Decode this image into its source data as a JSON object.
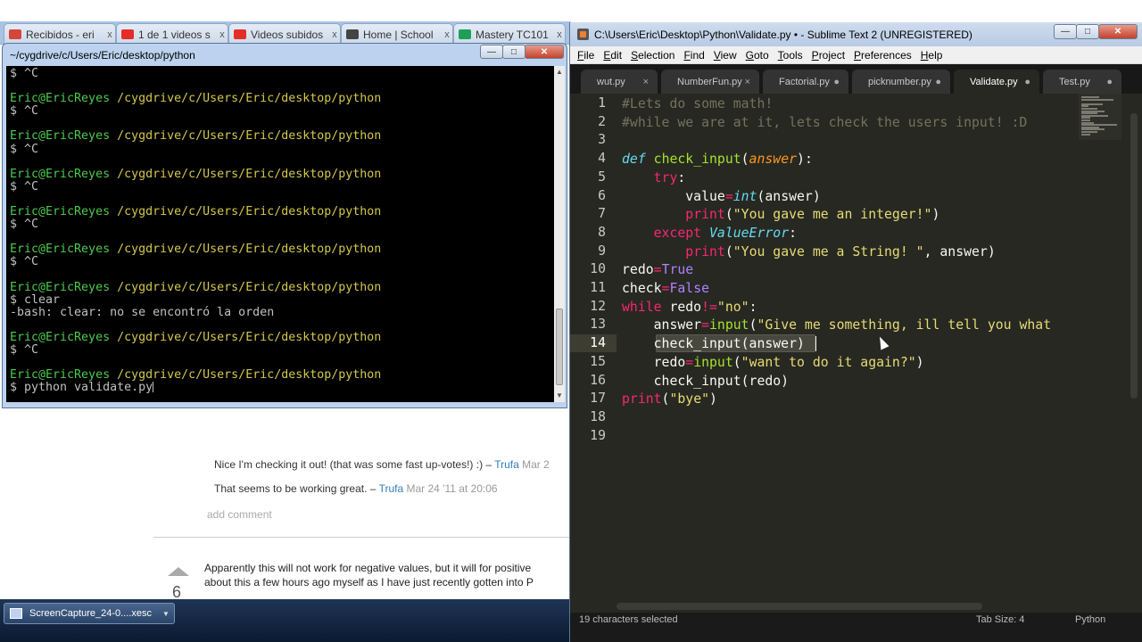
{
  "browser": {
    "tabs": [
      {
        "label": "Recibidos - eri",
        "icon": "gmail-icon",
        "color": "#d44638"
      },
      {
        "label": "1 de 1 videos s",
        "icon": "youtube-icon",
        "color": "#e52d27"
      },
      {
        "label": "Videos subidos",
        "icon": "youtube-icon",
        "color": "#e52d27"
      },
      {
        "label": "Home | School",
        "icon": "school-icon",
        "color": "#444444"
      },
      {
        "label": "Mastery TC101",
        "icon": "sheets-icon",
        "color": "#1e9e57"
      }
    ],
    "tab_close": "x",
    "comments": [
      {
        "text": "Nice I'm checking it out! (that was some fast up-votes!) :) –",
        "user": "Trufa",
        "date": "Mar 2"
      },
      {
        "text": "That seems to be working great. –",
        "user": "Trufa",
        "date": "Mar 24 '11 at 20:06"
      }
    ],
    "add_comment": "add comment",
    "vote_count": "6",
    "answer_lines": [
      "Apparently this will not work for negative values, but it will for positive",
      "about this a few hours ago myself as I have just recently gotten into P"
    ],
    "taskbar_item": "ScreenCapture_24-0....xesc"
  },
  "cygwin": {
    "title": "~/cygdrive/c/Users/Eric/desktop/python",
    "buttons": {
      "minimize": "—",
      "maximize": "□",
      "close": "✕"
    },
    "lines": [
      {
        "t": "$ ^C"
      },
      {
        "t": ""
      },
      {
        "user": "Eric@EricReyes",
        "path": "/cygdrive/c/Users/Eric/desktop/python"
      },
      {
        "t": "$ ^C"
      },
      {
        "t": ""
      },
      {
        "user": "Eric@EricReyes",
        "path": "/cygdrive/c/Users/Eric/desktop/python"
      },
      {
        "t": "$ ^C"
      },
      {
        "t": ""
      },
      {
        "user": "Eric@EricReyes",
        "path": "/cygdrive/c/Users/Eric/desktop/python"
      },
      {
        "t": "$ ^C"
      },
      {
        "t": ""
      },
      {
        "user": "Eric@EricReyes",
        "path": "/cygdrive/c/Users/Eric/desktop/python"
      },
      {
        "t": "$ ^C"
      },
      {
        "t": ""
      },
      {
        "user": "Eric@EricReyes",
        "path": "/cygdrive/c/Users/Eric/desktop/python"
      },
      {
        "t": "$ ^C"
      },
      {
        "t": ""
      },
      {
        "user": "Eric@EricReyes",
        "path": "/cygdrive/c/Users/Eric/desktop/python"
      },
      {
        "t": "$ clear"
      },
      {
        "t": "-bash: clear: no se encontró la orden"
      },
      {
        "t": ""
      },
      {
        "user": "Eric@EricReyes",
        "path": "/cygdrive/c/Users/Eric/desktop/python"
      },
      {
        "t": "$ ^C"
      },
      {
        "t": ""
      },
      {
        "user": "Eric@EricReyes",
        "path": "/cygdrive/c/Users/Eric/desktop/python"
      },
      {
        "t": "$ python validate.py",
        "cursor": true
      }
    ]
  },
  "sublime": {
    "title": "C:\\Users\\Eric\\Desktop\\Python\\Validate.py • - Sublime Text 2 (UNREGISTERED)",
    "buttons": {
      "minimize": "—",
      "maximize": "□",
      "close": "✕"
    },
    "menu": [
      {
        "u": "F",
        "rest": "ile"
      },
      {
        "u": "E",
        "rest": "dit"
      },
      {
        "u": "S",
        "rest": "election"
      },
      {
        "u": "F",
        "rest": "ind"
      },
      {
        "u": "V",
        "rest": "iew"
      },
      {
        "u": "G",
        "rest": "oto"
      },
      {
        "u": "T",
        "rest": "ools"
      },
      {
        "u": "P",
        "rest": "roject"
      },
      {
        "u": "P",
        "rest": "references"
      },
      {
        "u": "H",
        "rest": "elp"
      }
    ],
    "tabs": [
      {
        "label": "wut.py",
        "close": "×"
      },
      {
        "label": "NumberFun.py",
        "close": "×"
      },
      {
        "label": "Factorial.py",
        "close": "●"
      },
      {
        "label": "picknumber.py",
        "close": "●"
      },
      {
        "label": "Validate.py",
        "close": "●",
        "active": true
      },
      {
        "label": "Test.py",
        "close": "●"
      }
    ],
    "current_line": 14,
    "code": [
      [
        [
          "c",
          "#Lets do some math!"
        ]
      ],
      [
        [
          "c",
          "#while we are at it, lets check the users input! :D"
        ]
      ],
      [],
      [
        [
          "b",
          "def"
        ],
        [
          "",
          " "
        ],
        [
          "f",
          "check_input"
        ],
        [
          "",
          "("
        ],
        [
          "p",
          "answer"
        ],
        [
          "",
          "):"
        ]
      ],
      [
        [
          "",
          "    "
        ],
        [
          "k",
          "try"
        ],
        [
          "",
          ":"
        ]
      ],
      [
        [
          "",
          "        value"
        ],
        [
          "o",
          "="
        ],
        [
          "b",
          "int"
        ],
        [
          "",
          "(answer)"
        ]
      ],
      [
        [
          "",
          "        "
        ],
        [
          "k",
          "print"
        ],
        [
          "",
          "("
        ],
        [
          "s",
          "\"You gave me an integer!\""
        ],
        [
          "",
          ")"
        ]
      ],
      [
        [
          "",
          "    "
        ],
        [
          "k",
          "except"
        ],
        [
          "",
          " "
        ],
        [
          "b",
          "ValueError"
        ],
        [
          "",
          ":"
        ]
      ],
      [
        [
          "",
          "        "
        ],
        [
          "k",
          "print"
        ],
        [
          "",
          "("
        ],
        [
          "s",
          "\"You gave me a String! \""
        ],
        [
          "",
          ", answer)"
        ]
      ],
      [
        [
          "",
          "redo"
        ],
        [
          "o",
          "="
        ],
        [
          "n",
          "True"
        ]
      ],
      [
        [
          "",
          "check"
        ],
        [
          "o",
          "="
        ],
        [
          "n",
          "False"
        ]
      ],
      [
        [
          "k",
          "while"
        ],
        [
          "",
          " redo"
        ],
        [
          "o",
          "!="
        ],
        [
          "s",
          "\"no\""
        ],
        [
          "",
          ":"
        ]
      ],
      [
        [
          "",
          "    answer"
        ],
        [
          "o",
          "="
        ],
        [
          "f",
          "input"
        ],
        [
          "",
          "("
        ],
        [
          "s",
          "\"Give me something, ill tell you what"
        ]
      ],
      [
        [
          "",
          "    check_input(answer)"
        ]
      ],
      [
        [
          "",
          "    redo"
        ],
        [
          "o",
          "="
        ],
        [
          "f",
          "input"
        ],
        [
          "",
          "("
        ],
        [
          "s",
          "\"want to do it again?\""
        ],
        [
          "",
          ")"
        ]
      ],
      [
        [
          "",
          "    check_input(redo)"
        ]
      ],
      [
        [
          "k",
          "print"
        ],
        [
          "",
          "("
        ],
        [
          "s",
          "\"bye\""
        ],
        [
          "",
          ")"
        ]
      ],
      [],
      []
    ],
    "status": {
      "left": "19 characters selected",
      "tab_size": "Tab Size: 4",
      "syntax": "Python"
    },
    "colors": {
      "background": "#272822",
      "keyword": "#f92672",
      "string": "#e6db74",
      "function": "#a6e22e",
      "comment": "#75715e"
    }
  }
}
